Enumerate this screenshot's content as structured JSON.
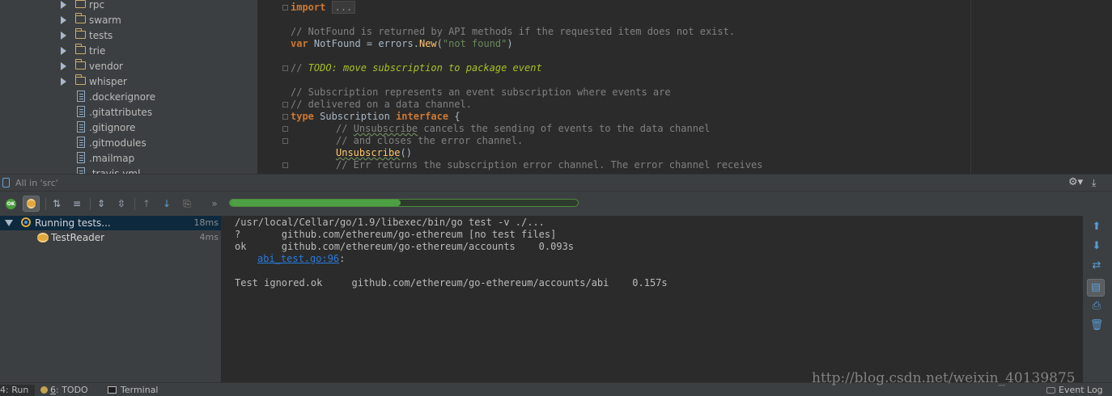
{
  "project_tree": {
    "items": [
      {
        "type": "folder",
        "label": "rpc"
      },
      {
        "type": "folder",
        "label": "swarm"
      },
      {
        "type": "folder",
        "label": "tests"
      },
      {
        "type": "folder",
        "label": "trie"
      },
      {
        "type": "folder",
        "label": "vendor"
      },
      {
        "type": "folder",
        "label": "whisper"
      },
      {
        "type": "file",
        "label": ".dockerignore"
      },
      {
        "type": "file",
        "label": ".gitattributes"
      },
      {
        "type": "file",
        "label": ".gitignore"
      },
      {
        "type": "file",
        "label": ".gitmodules"
      },
      {
        "type": "file",
        "label": ".mailmap"
      },
      {
        "type": "file",
        "label": ".travis.yml"
      }
    ]
  },
  "editor": {
    "import_kw": "import",
    "import_fold": "...",
    "comment_notfound": "// NotFound is returned by API methods if the requested item does not exist.",
    "var_kw": "var",
    "var_decl": " NotFound = errors.",
    "new_fn": "New",
    "paren_open": "(",
    "not_found_str": "\"not found\"",
    "paren_close": ")",
    "todo_prefix": "// ",
    "todo_text": "TODO: move subscription to package event",
    "comment_sub1": "// Subscription represents an event subscription where events are",
    "comment_sub2": "// delivered on a data channel.",
    "type_kw": "type",
    "type_name": " Subscription ",
    "interface_kw": "interface",
    "brace": " {",
    "comment_unsub_prefix": "// ",
    "comment_unsub_word": "Unsubscribe",
    "comment_unsub_rest": " cancels the sending of events to the data channel",
    "comment_unsub2": "// and closes the error channel.",
    "unsub_fn": "Unsubscribe",
    "unsub_parens": "()",
    "comment_err": "// Err returns the subscription error channel. The error channel receives"
  },
  "run_panel": {
    "title": "All in 'src'",
    "progress_percent": 49
  },
  "test_tree": {
    "items": [
      {
        "label": "Running tests...",
        "time": "18ms"
      },
      {
        "label": "TestReader",
        "time": "4ms"
      }
    ]
  },
  "console": {
    "lines": [
      "/usr/local/Cellar/go/1.9/libexec/bin/go test -v ./...",
      "?       github.com/ethereum/go-ethereum [no test files]",
      "ok      github.com/ethereum/go-ethereum/accounts    0.093s",
      "",
      "",
      "Test ignored.ok     github.com/ethereum/go-ethereum/accounts/abi    0.157s"
    ],
    "link_text": "abi_test.go:96",
    "link_suffix": ":"
  },
  "status_bar": {
    "run_tab": "4: Run",
    "todo_num": "6",
    "todo_tab": ": TODO",
    "terminal_tab": "Terminal",
    "event_log": "Event Log"
  },
  "watermark": "http://blog.csdn.net/weixin_40139875"
}
